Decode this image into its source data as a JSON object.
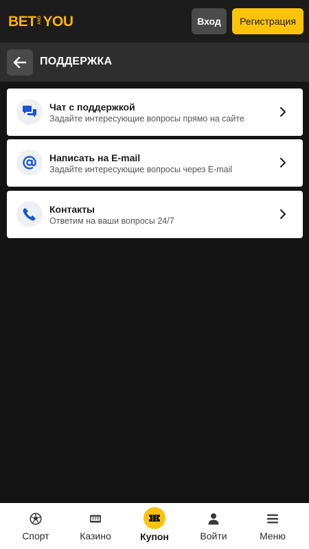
{
  "header": {
    "logo_bet": "BET",
    "logo_and": "AND",
    "logo_you": "YOU",
    "login_label": "Вход",
    "register_label": "Регистрация",
    "brand_color": "#fcc30a"
  },
  "titlebar": {
    "back_icon": "arrow-left-icon",
    "title": "ПОДДЕРЖКА"
  },
  "support_items": [
    {
      "icon": "chat-bubbles-icon",
      "title": "Чат с поддержкой",
      "subtitle": "Задайте интересующие вопросы прямо на сайте",
      "chevron": "chevron-right-icon"
    },
    {
      "icon": "at-sign-icon",
      "title": "Написать на E-mail",
      "subtitle": "Задайте интересующие вопросы через E-mail",
      "chevron": "chevron-right-icon"
    },
    {
      "icon": "phone-icon",
      "title": "Контакты",
      "subtitle": "Ответим на ваши вопросы 24/7",
      "chevron": "chevron-right-icon"
    }
  ],
  "bottom_nav": [
    {
      "icon": "soccer-ball-icon",
      "label": "Спорт"
    },
    {
      "icon": "slot-machine-icon",
      "label": "Казино",
      "badge": "777"
    },
    {
      "icon": "ticket-icon",
      "label": "Купон",
      "active": true
    },
    {
      "icon": "user-icon",
      "label": "Войти"
    },
    {
      "icon": "menu-icon",
      "label": "Меню"
    }
  ],
  "colors": {
    "background": "#141414",
    "accent_icon": "#1a56db",
    "card": "#ffffff"
  }
}
